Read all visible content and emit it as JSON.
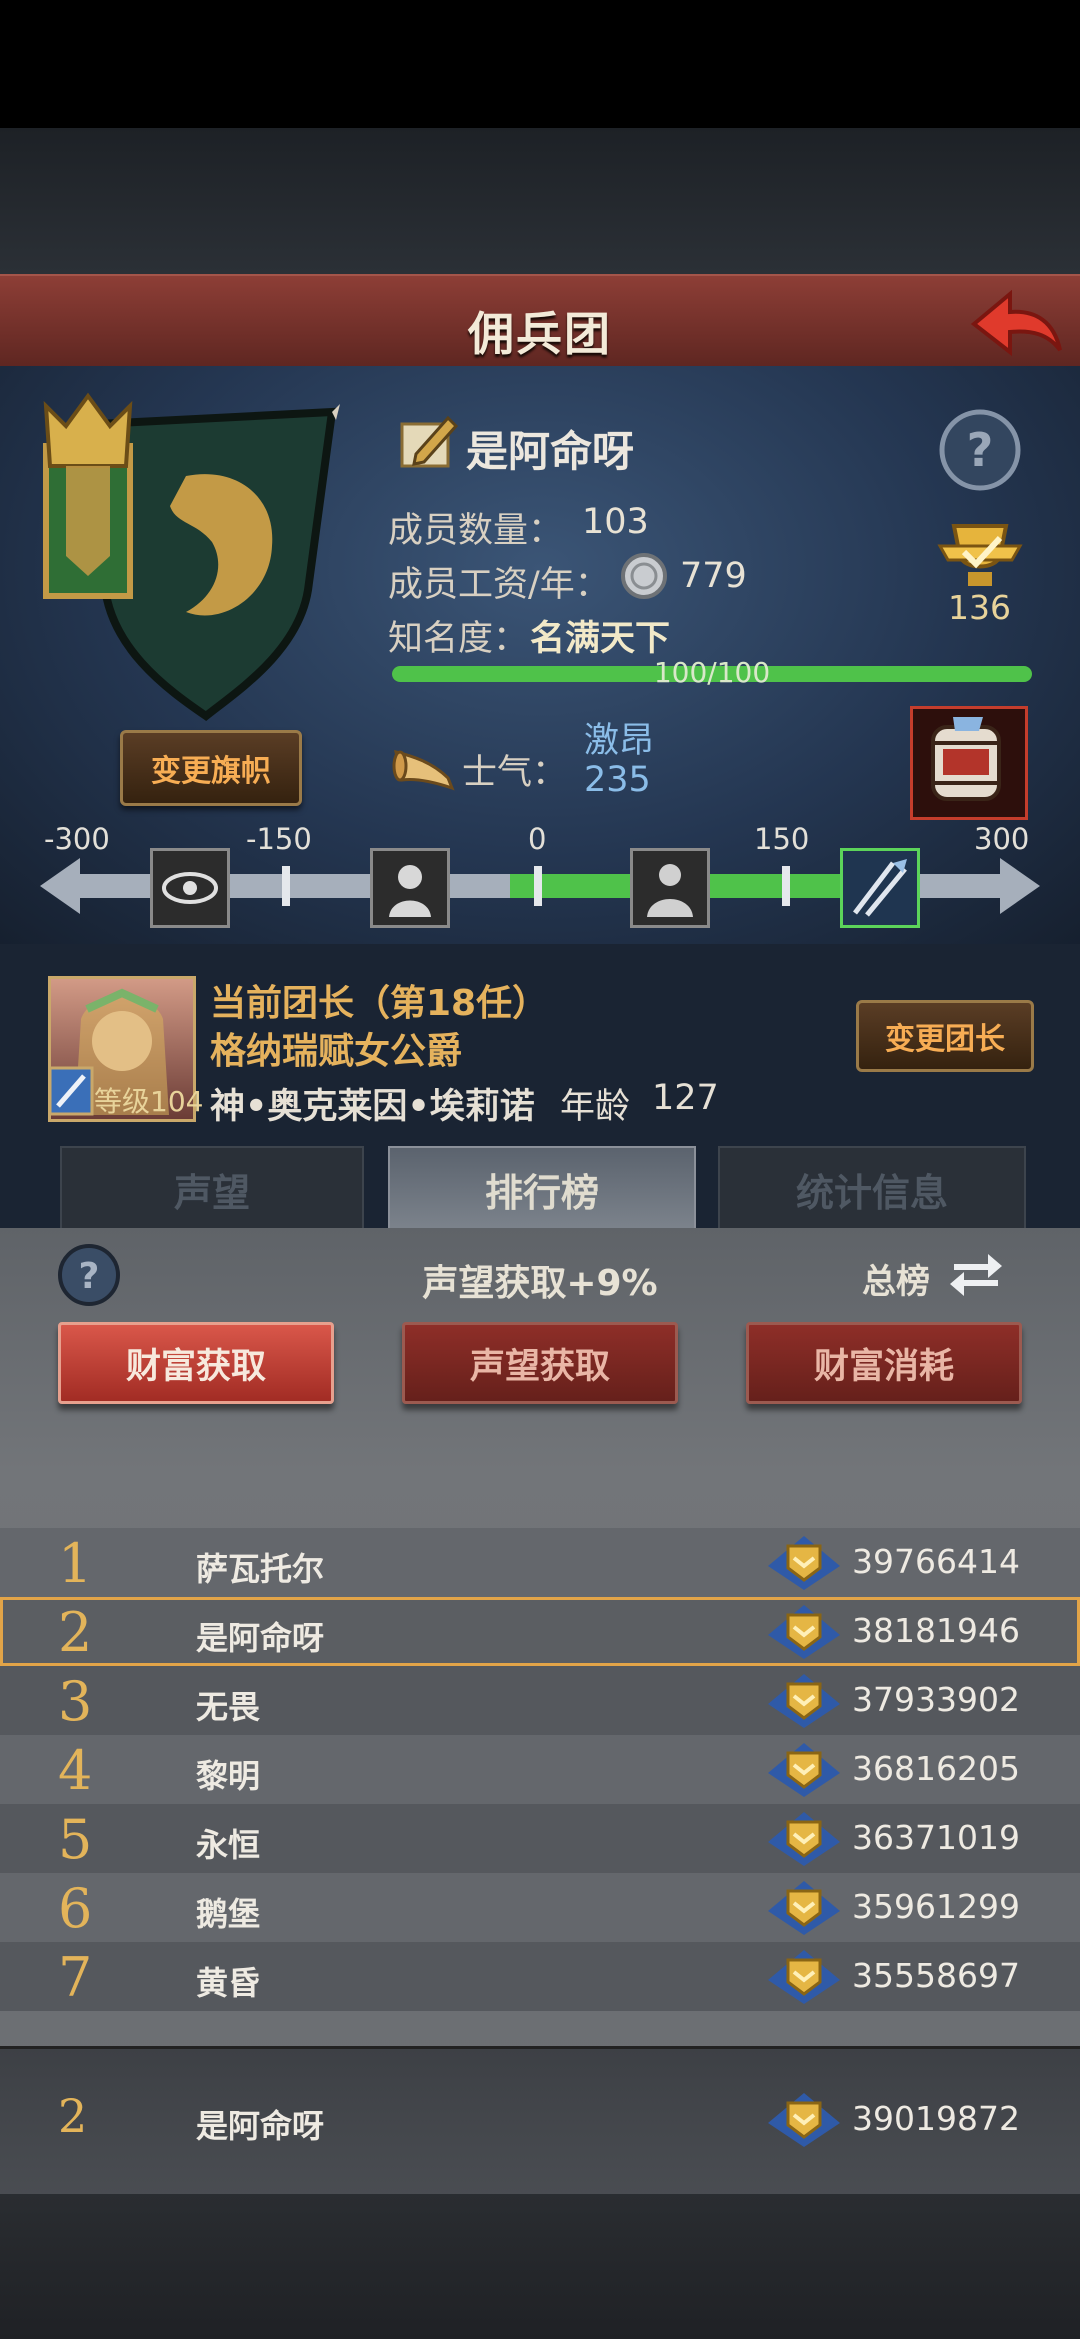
{
  "header": {
    "title": "佣兵团"
  },
  "guild": {
    "name": "是阿命呀",
    "members_label": "成员数量：",
    "members_value": "103",
    "wage_label": "成员工资/年：",
    "wage_value": "779",
    "fame_label": "知名度：",
    "fame_value": "名满天下",
    "fame_bar_text": "100/100",
    "fame_progress": 1.0,
    "cup_value": "136",
    "change_banner_label": "变更旗帜"
  },
  "morale": {
    "label": "士气：",
    "state": "激昂",
    "value": "235",
    "scale_ticks": [
      "-300",
      "-150",
      "0",
      "150",
      "300"
    ]
  },
  "leader": {
    "title": "当前团长（第18任）",
    "name": "格纳瑞赋女公爵",
    "full_name": "神•奥克莱因•埃莉诺",
    "age_label": "年龄",
    "age_value": "127",
    "level_label": "等级104",
    "change_leader_label": "变更团长"
  },
  "tabs": [
    {
      "label": "声望",
      "active": false
    },
    {
      "label": "排行榜",
      "active": true
    },
    {
      "label": "统计信息",
      "active": false
    }
  ],
  "leaderboard": {
    "bonus_text": "声望获取+9%",
    "total_label": "总榜",
    "sub_tabs": [
      {
        "label": "财富获取",
        "active": true
      },
      {
        "label": "声望获取",
        "active": false
      },
      {
        "label": "财富消耗",
        "active": false
      }
    ],
    "rows": [
      {
        "rank": "1",
        "name": "萨瓦托尔",
        "value": "39766414"
      },
      {
        "rank": "2",
        "name": "是阿命呀",
        "value": "38181946"
      },
      {
        "rank": "3",
        "name": "无畏",
        "value": "37933902"
      },
      {
        "rank": "4",
        "name": "黎明",
        "value": "36816205"
      },
      {
        "rank": "5",
        "name": "永恒",
        "value": "36371019"
      },
      {
        "rank": "6",
        "name": "鹅堡",
        "value": "35961299"
      },
      {
        "rank": "7",
        "name": "黄昏",
        "value": "35558697"
      }
    ],
    "self": {
      "rank": "2",
      "name": "是阿命呀",
      "value": "39019872"
    }
  },
  "colors": {
    "accent_gold": "#e3b45a",
    "title_red": "#8d3e36",
    "highlight": "#e2a448",
    "fame_green": "#4fc24a"
  }
}
